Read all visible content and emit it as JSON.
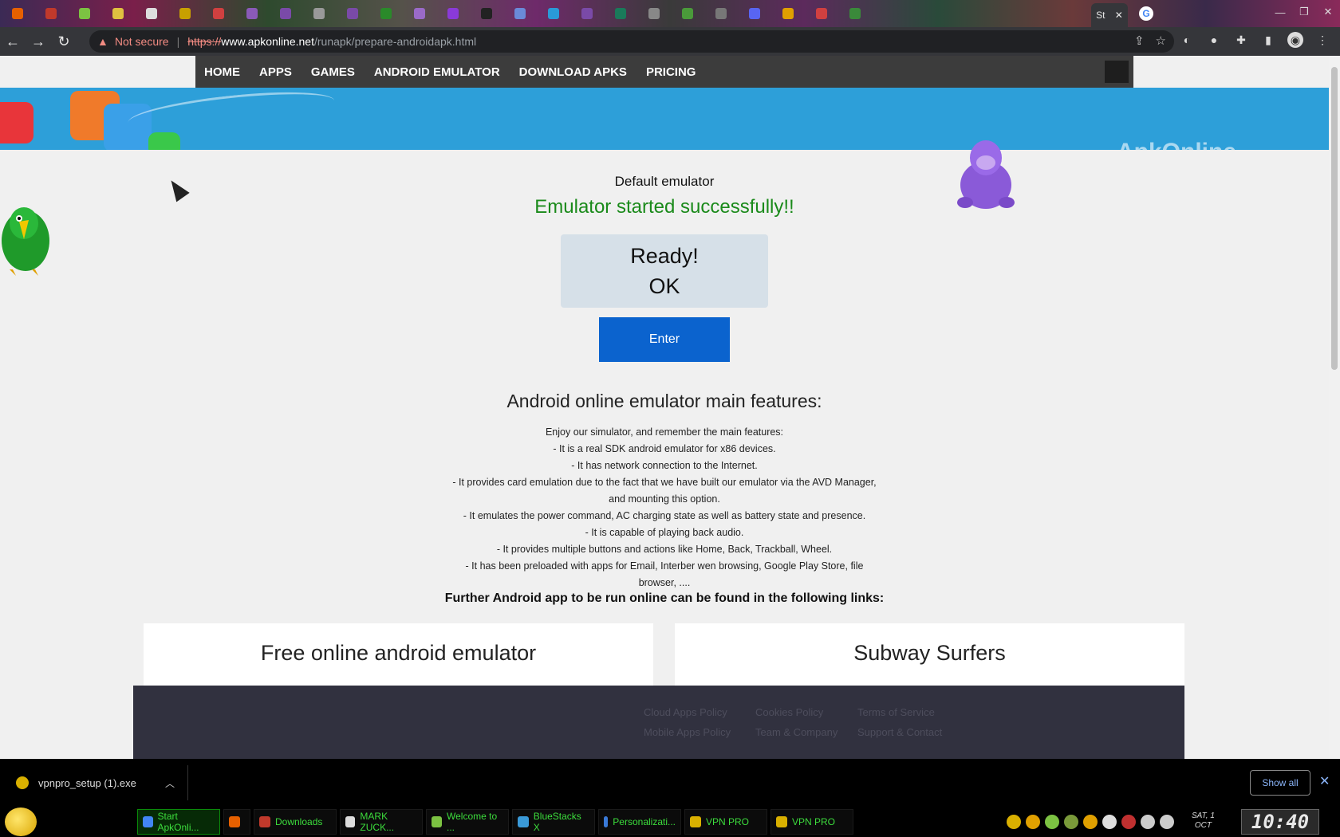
{
  "browser": {
    "tabs": [
      {
        "icon": "firefox-icon",
        "color": "#e66000"
      },
      {
        "icon": "puzzle-icon",
        "color": "#c0392b"
      },
      {
        "icon": "bird-icon",
        "color": "#7cc242"
      },
      {
        "icon": "layers-icon",
        "color": "#e0c040"
      },
      {
        "icon": "grid-icon",
        "color": "#dddddd"
      },
      {
        "icon": "bookmark-icon",
        "color": "#c8a000"
      },
      {
        "icon": "red-tab-icon",
        "color": "#d04040"
      },
      {
        "icon": "purple-tab-icon",
        "color": "#8a5ab8"
      },
      {
        "icon": "purple-tab-icon",
        "color": "#7a4aa8"
      },
      {
        "icon": "gray-tab-icon",
        "color": "#999999"
      },
      {
        "icon": "purple-tab-icon",
        "color": "#7a4aa8"
      },
      {
        "icon": "green-tab-icon",
        "color": "#2a8a2a"
      },
      {
        "icon": "rss-icon",
        "color": "#9a6ac8"
      },
      {
        "icon": "c-icon",
        "color": "#8a3ad8"
      },
      {
        "icon": "three-icon",
        "color": "#222222"
      },
      {
        "icon": "rso-icon",
        "color": "#6a8ad8"
      },
      {
        "icon": "s-icon",
        "color": "#2a9ad8"
      },
      {
        "icon": "purple-tab-icon",
        "color": "#7a4aa8"
      },
      {
        "icon": "green-tab-icon",
        "color": "#1a7a5a"
      },
      {
        "icon": "gray-tab-icon",
        "color": "#888888"
      },
      {
        "icon": "green-tab-icon",
        "color": "#4a9a3a"
      },
      {
        "icon": "gray-tab-icon",
        "color": "#777777"
      },
      {
        "icon": "discord-icon",
        "color": "#5865f2"
      },
      {
        "icon": "folder-icon",
        "color": "#e0a000"
      },
      {
        "icon": "r-icon",
        "color": "#d04040"
      },
      {
        "icon": "green-tab-icon",
        "color": "#3a8a3a"
      }
    ],
    "active_tab_label": "St",
    "url_warning": "Not secure",
    "url_scheme": "https://",
    "url_host": "www.apkonline.net",
    "url_path": "/runapk/prepare-androidapk.html"
  },
  "site_nav": [
    "HOME",
    "APPS",
    "GAMES",
    "ANDROID EMULATOR",
    "DOWNLOAD APKS",
    "PRICING"
  ],
  "banner": {
    "faint_text": "ApkOnline"
  },
  "main": {
    "default_emulator": "Default emulator",
    "status": "Emulator started successfully!!",
    "ready_line1": "Ready!",
    "ready_line2": "OK",
    "enter_label": "Enter",
    "features_title": "Android online emulator main features:",
    "features": [
      "Enjoy our simulator, and remember the main features:",
      "- It is a real SDK android emulator for x86 devices.",
      "- It has network connection to the Internet.",
      "- It provides card emulation due to the fact that we have built our emulator via the AVD Manager, and mounting this option.",
      "- It emulates the power command, AC charging state as well as battery state and presence.",
      "- It is capable of playing back audio.",
      "- It provides multiple buttons and actions like Home, Back, Trackball, Wheel.",
      "- It has been preloaded with apps for Email, Interber wen browsing, Google Play Store, file browser, ...."
    ],
    "further_links": "Further Android app to be run online can be found in the following links:",
    "cards": [
      "Free online android emulator",
      "Subway Surfers"
    ]
  },
  "footer": {
    "links": [
      "Cloud Apps Policy",
      "Cookies Policy",
      "Terms of Service",
      "Mobile Apps Policy",
      "Team & Company",
      "Support & Contact"
    ]
  },
  "downloads": {
    "file_name": "vpnpro_setup (1).exe",
    "show_all": "Show all"
  },
  "taskbar": {
    "tasks": [
      {
        "label": "Start ApkOnli...",
        "icon": "chrome-icon",
        "color": "#4285f4",
        "active": true
      },
      {
        "label": "",
        "icon": "firefox-icon",
        "color": "#e66000",
        "active": false
      },
      {
        "label": "Downloads",
        "icon": "downloads-icon",
        "color": "#c0392b",
        "active": false
      },
      {
        "label": "MARK ZUCK...",
        "icon": "document-icon",
        "color": "#dddddd",
        "active": false
      },
      {
        "label": "Welcome to ...",
        "icon": "bird-icon",
        "color": "#7cc242",
        "active": false
      },
      {
        "label": "BlueStacks X",
        "icon": "bluestacks-icon",
        "color": "#3a9ad8",
        "active": false
      },
      {
        "label": "Personalizati...",
        "icon": "monitor-icon",
        "color": "#3a7ad8",
        "active": false
      },
      {
        "label": "VPN PRO",
        "icon": "vpn-icon",
        "color": "#d9b000",
        "active": false
      },
      {
        "label": "VPN PRO",
        "icon": "vpn-icon",
        "color": "#d9b000",
        "active": false
      }
    ],
    "date_line1": "SAT, 1",
    "date_line2": "OCT",
    "clock": "10:40"
  }
}
